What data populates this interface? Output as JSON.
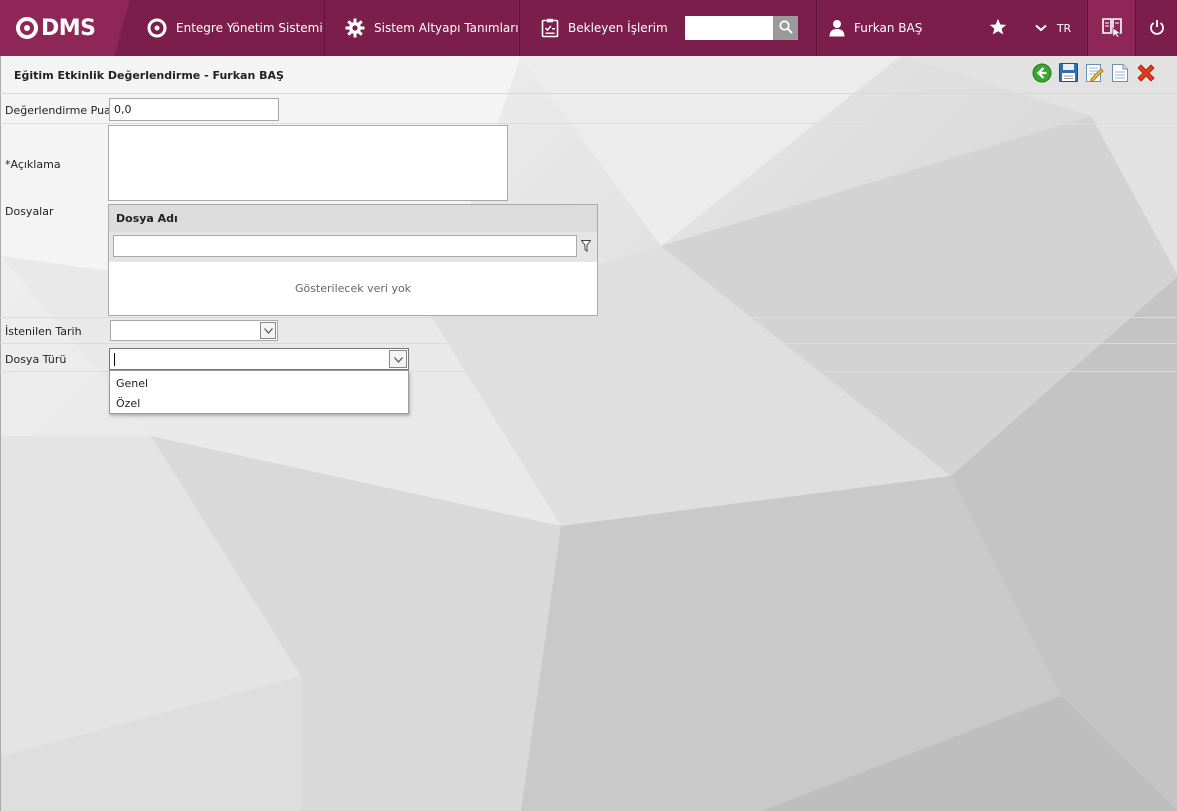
{
  "topbar": {
    "logo_text": "DMS",
    "nav": [
      {
        "label": "Entegre Yönetim Sistemi",
        "icon": "qdms-circle-icon"
      },
      {
        "label": "Sistem Altyapı Tanımları",
        "icon": "gear-icon"
      },
      {
        "label": "Bekleyen İşlerim",
        "icon": "clipboard-check-icon"
      }
    ],
    "search_value": "",
    "user_name": "Furkan BAŞ",
    "language": "TR",
    "colors": {
      "bar": "#7b1e4b",
      "logo_bg": "#8e2758"
    }
  },
  "page": {
    "title": "Eğitim Etkinlik Değerlendirme - Furkan BAŞ",
    "toolbar_icons": [
      "back-arrow-icon",
      "save-icon",
      "edit-document-icon",
      "new-document-icon",
      "close-icon"
    ]
  },
  "form": {
    "score_label": "Değerlendirme Puanı",
    "score_value": "0,0",
    "description_label": "*Açıklama",
    "description_value": "",
    "files_label": "Dosyalar",
    "files_grid": {
      "column_header": "Dosya Adı",
      "filter_value": "",
      "empty_text": "Gösterilecek veri yok"
    },
    "requested_date_label": "İstenilen Tarih",
    "requested_date_value": "",
    "file_type_label": "Dosya Türü",
    "file_type_value": "",
    "file_type_options": [
      "Genel",
      "Özel"
    ]
  }
}
